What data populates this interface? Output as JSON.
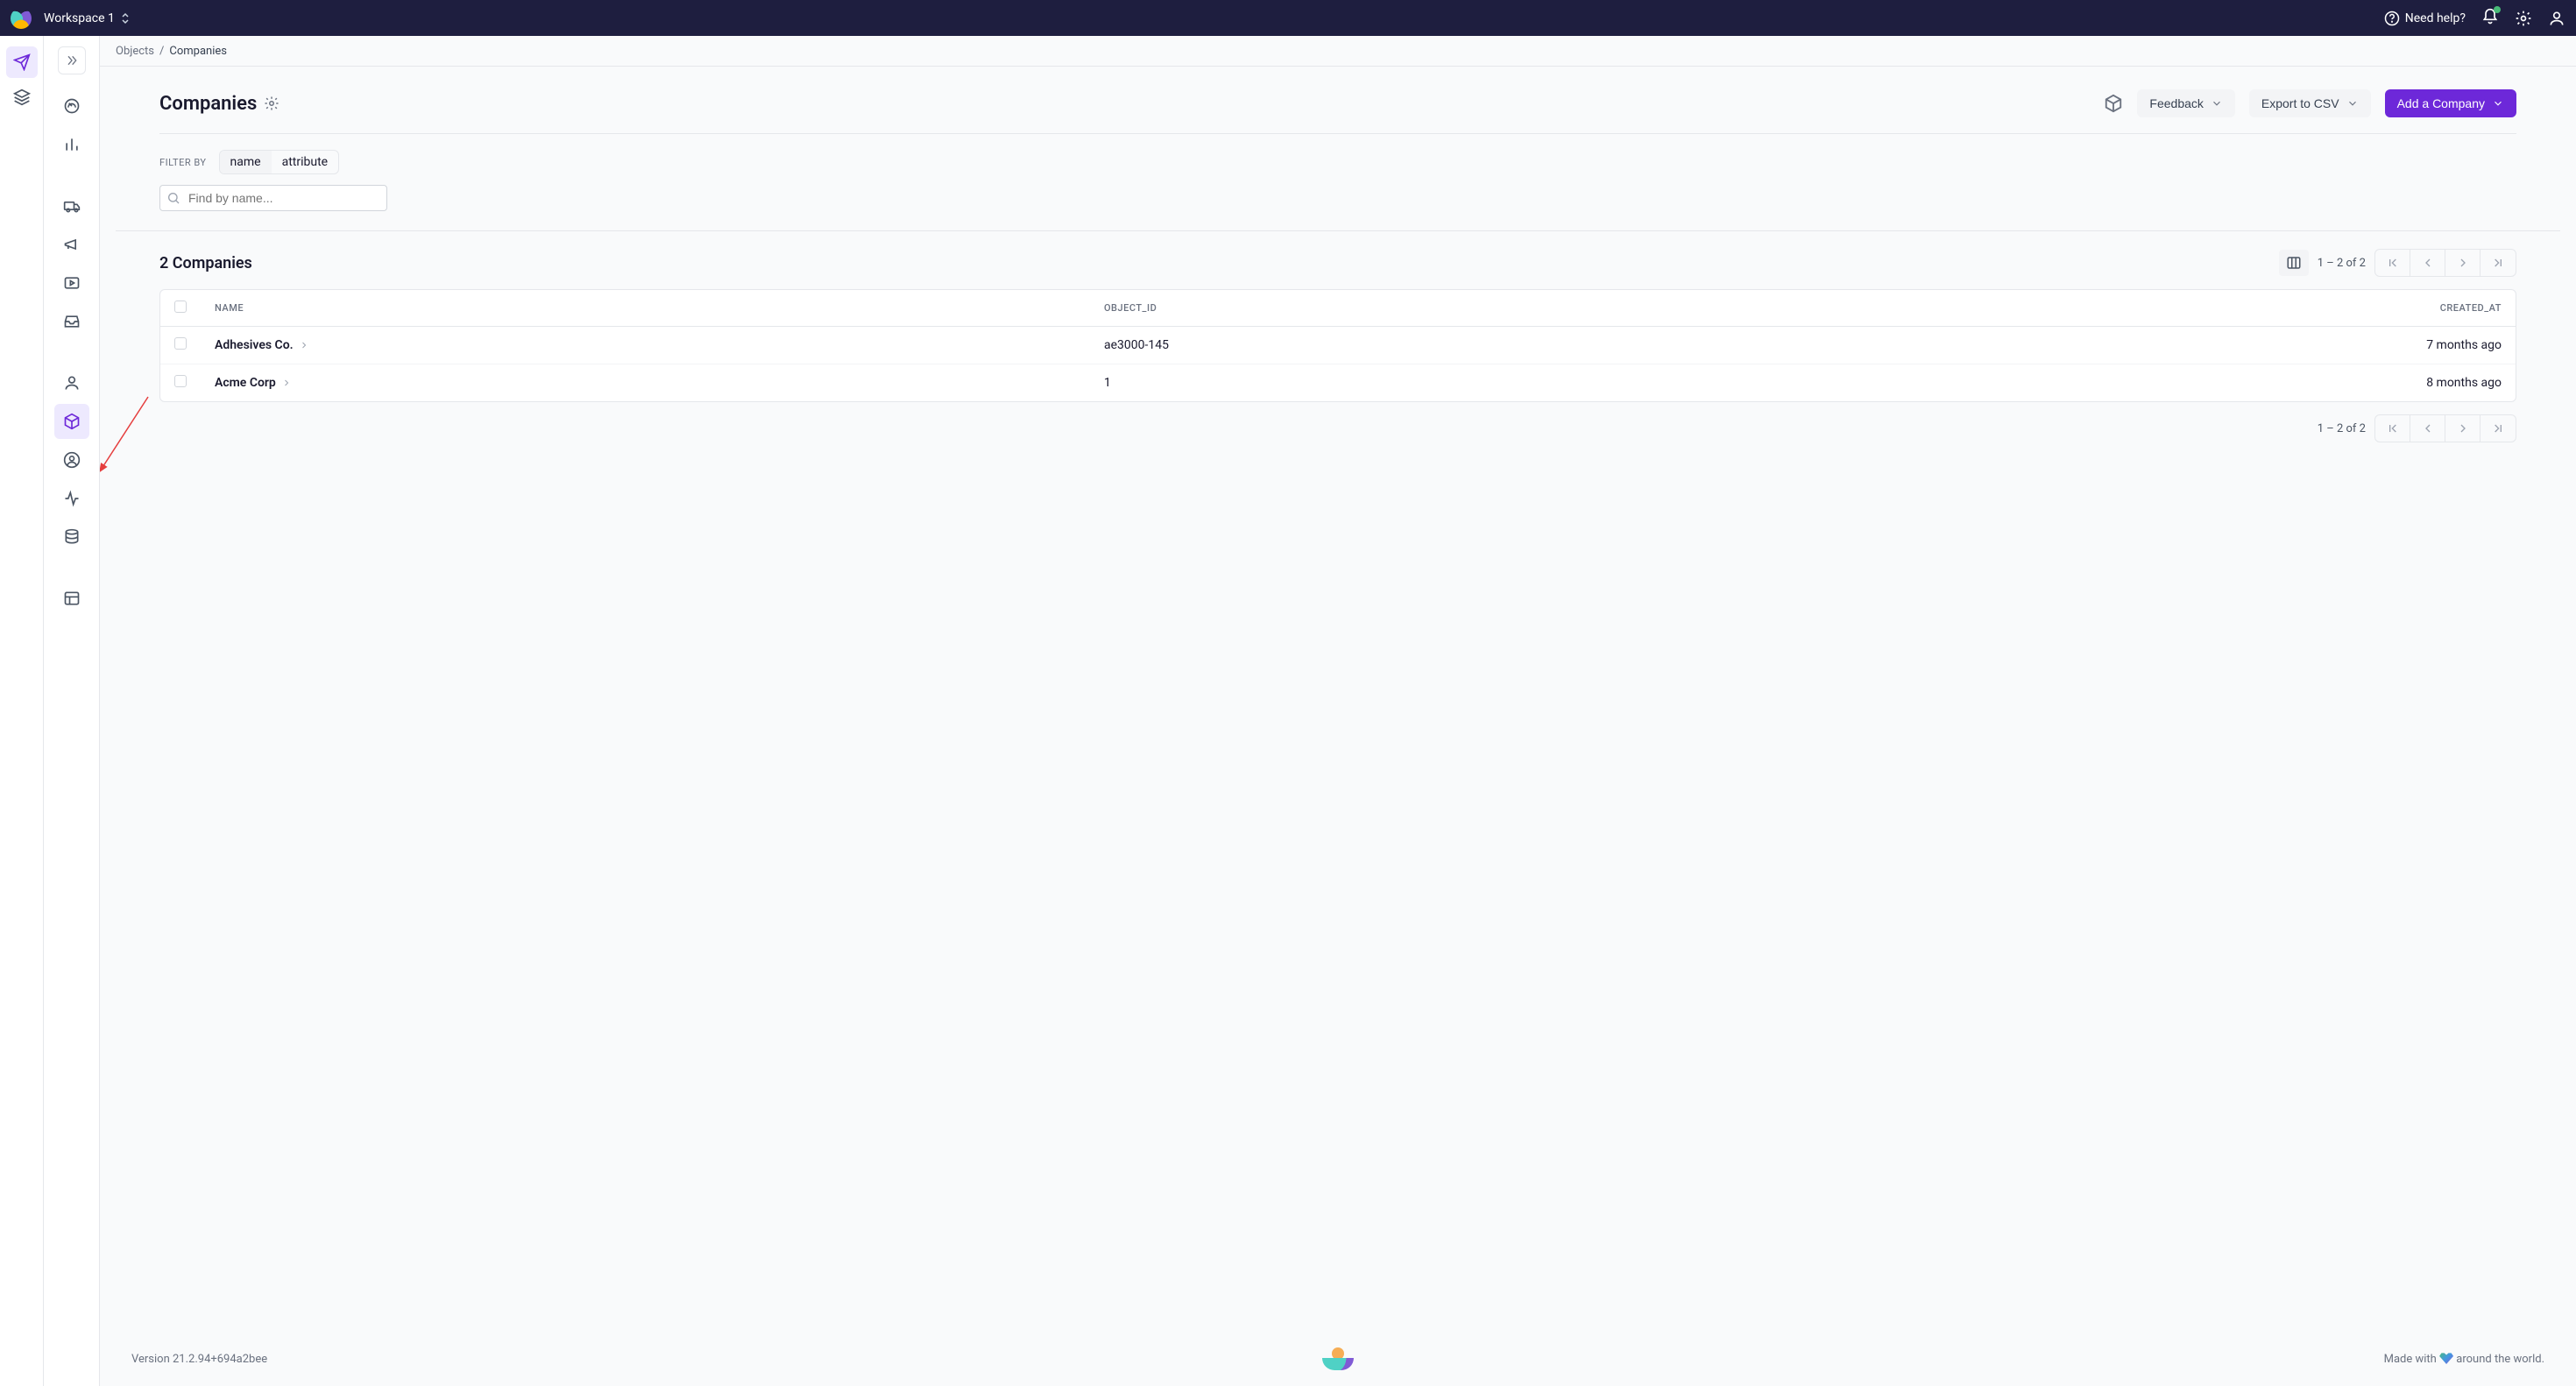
{
  "topbar": {
    "workspace": "Workspace 1",
    "help": "Need help?"
  },
  "breadcrumbs": {
    "parent": "Objects",
    "sep": "/",
    "current": "Companies"
  },
  "page": {
    "title": "Companies",
    "feedback": "Feedback",
    "export": "Export to CSV",
    "add": "Add a Company"
  },
  "filter": {
    "label": "FILTER BY",
    "opt_name": "name",
    "opt_attr": "attribute",
    "search_placeholder": "Find by name..."
  },
  "list": {
    "count_label": "2 Companies",
    "range": "1 – 2 of 2"
  },
  "columns": {
    "name": "NAME",
    "object_id": "OBJECT_ID",
    "created_at": "CREATED_AT"
  },
  "rows": [
    {
      "name": "Adhesives Co.",
      "object_id": "ae3000-145",
      "created_at": "7 months ago"
    },
    {
      "name": "Acme Corp",
      "object_id": "1",
      "created_at": "8 months ago"
    }
  ],
  "footer": {
    "version": "Version 21.2.94+694a2bee",
    "made_pre": "Made with ",
    "made_post": " around the world."
  }
}
